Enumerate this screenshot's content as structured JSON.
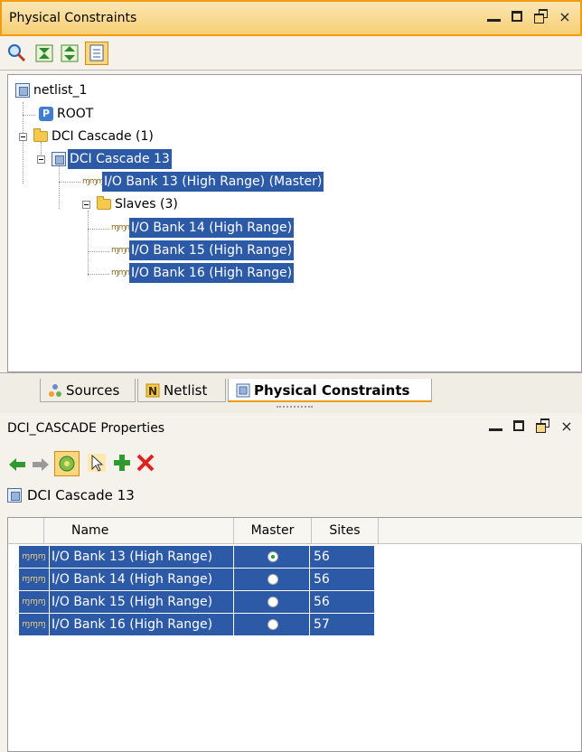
{
  "top_panel": {
    "title": "Physical Constraints",
    "toolbar_icons": [
      "search-icon",
      "collapse-all-icon",
      "expand-all-icon",
      "show-hierarchy-icon"
    ],
    "tree": {
      "root": "netlist_1",
      "root_child": "ROOT",
      "cascade_group": "DCI Cascade (1)",
      "cascade": "DCI Cascade 13",
      "master": "I/O Bank 13 (High Range) (Master)",
      "slaves_folder": "Slaves (3)",
      "slaves": [
        "I/O Bank 14 (High Range)",
        "I/O Bank 15 (High Range)",
        "I/O Bank 16 (High Range)"
      ]
    }
  },
  "tabs": [
    {
      "label": "Sources",
      "icon": "sources-icon",
      "active": false
    },
    {
      "label": "Netlist",
      "icon": "netlist-icon",
      "active": false
    },
    {
      "label": "Physical Constraints",
      "icon": "physical-constraints-icon",
      "active": true
    }
  ],
  "bottom_panel": {
    "title": "DCI_CASCADE Properties",
    "toolbar_icons": [
      "back-icon",
      "forward-icon",
      "auto-update-icon",
      "select-icon",
      "add-icon",
      "delete-icon"
    ],
    "object_name": "DCI Cascade 13",
    "table": {
      "headers": [
        "Name",
        "Master",
        "Sites"
      ],
      "rows": [
        {
          "name": "I/O Bank 13 (High Range)",
          "master": true,
          "sites": "56"
        },
        {
          "name": "I/O Bank 14 (High Range)",
          "master": false,
          "sites": "56"
        },
        {
          "name": "I/O Bank 15 (High Range)",
          "master": false,
          "sites": "56"
        },
        {
          "name": "I/O Bank 16 (High Range)",
          "master": false,
          "sites": "57"
        }
      ]
    }
  },
  "window_buttons": {
    "minimize": "minimize",
    "maximize": "maximize",
    "restore": "restore",
    "close": "×"
  },
  "colors": {
    "selection": "#2d5aa7",
    "active_border": "#f39c12",
    "titlebar_active": "#f7cf73"
  }
}
